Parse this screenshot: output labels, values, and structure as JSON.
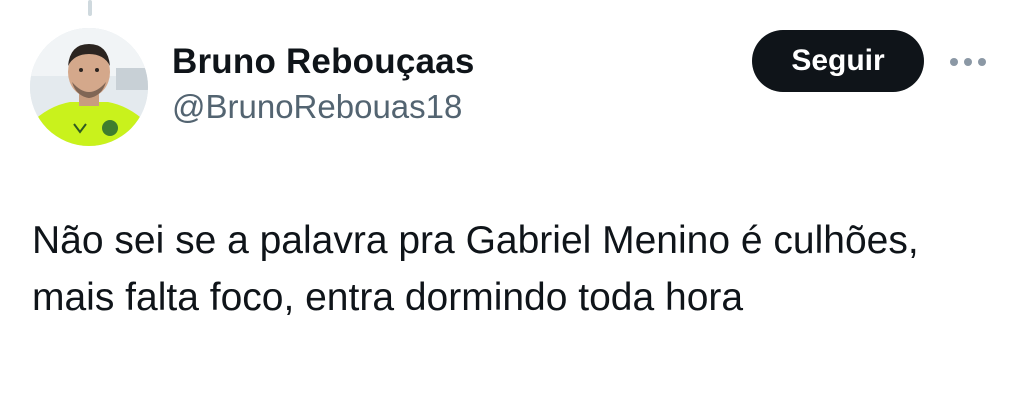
{
  "author": {
    "display_name": "Bruno Rebouçaas",
    "handle": "@BrunoRebouas18",
    "avatar_icon": "profile-photo"
  },
  "actions": {
    "follow_label": "Seguir",
    "more_icon": "more-options-icon"
  },
  "tweet": {
    "text": "Não sei se a palavra pra Gabriel Menino é culhões, mais falta foco, entra dormindo toda hora"
  },
  "colors": {
    "primary_text": "#0f1419",
    "secondary_text": "#536471",
    "button_bg": "#0f1419",
    "button_text": "#ffffff",
    "jersey": "#c9f21c"
  }
}
